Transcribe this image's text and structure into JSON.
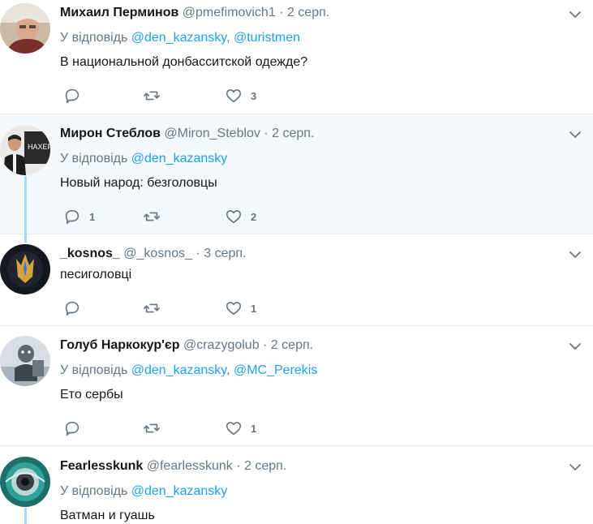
{
  "colors": {
    "link": "#1da1f2",
    "meta": "#657786",
    "text": "#14171a",
    "thread": "#a4d9f9",
    "highlight": "#f5f8fa"
  },
  "tweets": [
    {
      "name": "Михаил Перминов",
      "handle": "@pmefimovich1",
      "sep": "·",
      "date": "2 серп.",
      "reply_prefix": "У відповідь",
      "mentions": [
        "@den_kazansky",
        "@turistmen"
      ],
      "text": "В национальной донбасситской одежде?",
      "replies": "",
      "retweets": "",
      "likes": "3"
    },
    {
      "name": "Мирон Стеблов",
      "handle": "@Miron_Steblov",
      "sep": "·",
      "date": "2 серп.",
      "reply_prefix": "У відповідь",
      "mentions": [
        "@den_kazansky"
      ],
      "text": "Новый народ: безголовцы",
      "replies": "1",
      "retweets": "",
      "likes": "2"
    },
    {
      "name": "_kosnos_",
      "handle": "@_kosnos_",
      "sep": "·",
      "date": "3 серп.",
      "text": "песиголовці",
      "replies": "",
      "retweets": "",
      "likes": "1"
    },
    {
      "name": "Голуб Наркокур'єр",
      "handle": "@crazygolub",
      "sep": "·",
      "date": "2 серп.",
      "reply_prefix": "У відповідь",
      "mentions": [
        "@den_kazansky",
        "@MC_Perekis"
      ],
      "text": "Ето сербы",
      "replies": "",
      "retweets": "",
      "likes": "1"
    },
    {
      "name": "Fearlesskunk",
      "handle": "@fearlesskunk",
      "sep": "·",
      "date": "2 серп.",
      "reply_prefix": "У відповідь",
      "mentions": [
        "@den_kazansky"
      ],
      "text": "Ватман и гуашь"
    }
  ]
}
